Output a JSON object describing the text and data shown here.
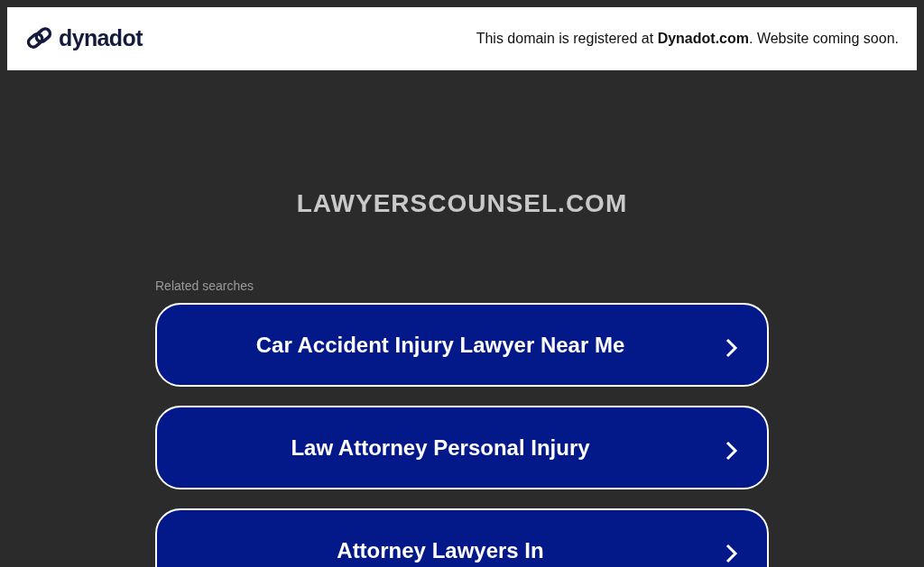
{
  "header": {
    "logo_text": "dynadot",
    "notice": "This domain is registered at **Dynadot.com**. Website coming soon."
  },
  "domain_title": "LAWYERSCOUNSEL.COM",
  "related_label": "Related searches",
  "searches": [
    {
      "label": "Car Accident Injury Lawyer Near Me"
    },
    {
      "label": "Law Attorney Personal Injury"
    },
    {
      "label": "Attorney Lawyers In"
    }
  ]
}
